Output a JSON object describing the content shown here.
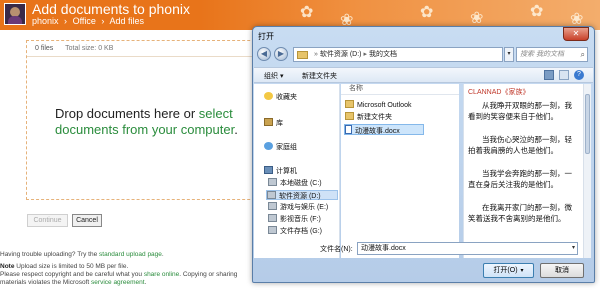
{
  "page": {
    "title": "Add documents to phonix",
    "breadcrumb": [
      "phonix",
      "›",
      "Office",
      "›",
      "Add files"
    ],
    "file_count": "0 files",
    "total_size": "Total size: 0 KB",
    "drop_text": "Drop documents here or ",
    "drop_link": "select documents from your",
    "drop_link2": "computer",
    "drop_end": ".",
    "continue_label": "Continue",
    "cancel_label": "Cancel",
    "help_text": "Having trouble uploading? Try the ",
    "help_link": "standard upload page",
    "help_end": ".",
    "note_label": "Note",
    "note_text1": "Upload size is limited to 50 MB per file.",
    "note_text2": "Please respect copyright and be careful what you ",
    "note_link1": "share online",
    "note_text3": ". Copying or sharing",
    "note_text4": "materials violates the Microsoft ",
    "note_link2": "service agreement",
    "note_text5": ".",
    "accent_color": "#e8741a",
    "link_color": "#2a8c3c"
  },
  "dialog": {
    "title": "打开",
    "close_glyph": "✕",
    "path": [
      "软件资源 (D:)",
      "我的文档"
    ],
    "search_placeholder": "搜索 我的文档",
    "toolbar": {
      "organize": "组织 ▾",
      "new_folder": "新建文件夹"
    },
    "nav": {
      "favorites": "收藏夹",
      "library": "库",
      "homegroup": "家庭组",
      "computer": "计算机",
      "drives": [
        "本地磁盘 (C:)",
        "软件资源 (D:)",
        "游戏与娱乐 (E:)",
        "影视音乐 (F:)",
        "文件存档 (G:)"
      ]
    },
    "column_name": "名称",
    "files": [
      {
        "name": "Microsoft Outlook",
        "type": "folder"
      },
      {
        "name": "新建文件夹",
        "type": "folder"
      },
      {
        "name": "动漫故事.docx",
        "type": "doc"
      }
    ],
    "preview": {
      "title": "CLANNAD《家族》",
      "paragraphs": [
        "从我睁开双眼的那一刻，我看到的笑容便来自于他们。",
        "当我伤心哭泣的那一刻，轻拍着我肩膀的人也是他们。",
        "当我学会奔跑的那一刻，一直在身后关注我的是他们。",
        "在我离开家门的那一刻，微笑着送我不舍离别的是他们。"
      ]
    },
    "filename_label": "文件名(N):",
    "filename_value": "动漫故事.docx",
    "open_label": "打开(O)",
    "open_arrow": "▾",
    "cancel_label": "取消"
  }
}
